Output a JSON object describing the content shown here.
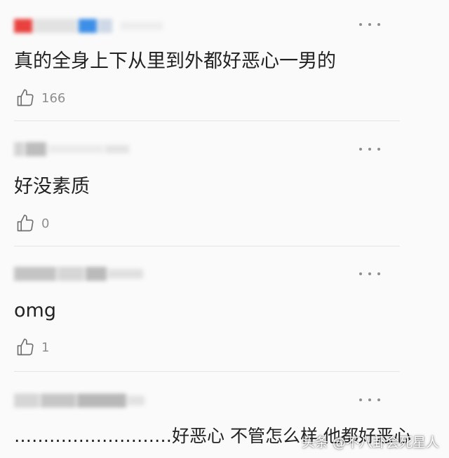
{
  "comments": [
    {
      "username": "",
      "text": "真的全身上下从里到外都好恶心一男的",
      "likes": "166"
    },
    {
      "username": "",
      "text": "好没素质",
      "likes": "0"
    },
    {
      "username": "",
      "text": "omg",
      "likes": "1"
    },
    {
      "username": "",
      "text": "………………………好恶心 不管怎么样 他都好恶心"
    }
  ],
  "icons": {
    "more": "more-horizontal-icon",
    "like": "thumbs-up-icon"
  },
  "watermark": "头条 @不八卦会死星人",
  "colors": {
    "background": "#fafafa",
    "text": "#222222",
    "muted": "#8e8e8e",
    "divider": "#e5e5e5",
    "avatar_red": "#e8413e",
    "avatar_blue": "#3d8ee6"
  }
}
